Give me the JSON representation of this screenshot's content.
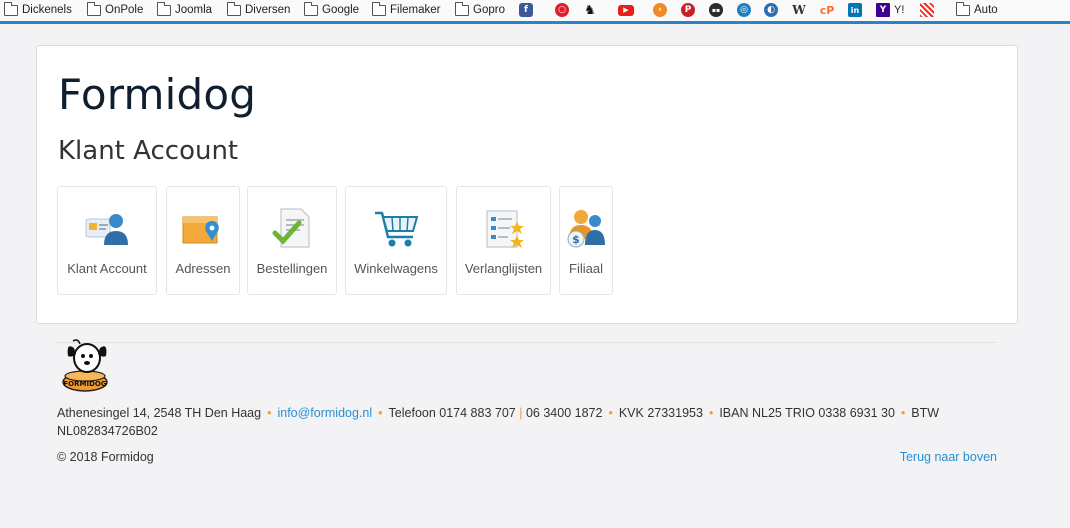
{
  "bookmarks": {
    "folders": [
      {
        "label": "Dickenels"
      },
      {
        "label": "OnPole"
      },
      {
        "label": "Joomla"
      },
      {
        "label": "Diversen"
      },
      {
        "label": "Google"
      },
      {
        "label": "Filemaker"
      },
      {
        "label": "Gopro"
      }
    ],
    "icons": [
      {
        "name": "facebook-icon",
        "glyph": "f",
        "color": "#3b5998"
      },
      {
        "name": "target-icon",
        "glyph": "◉",
        "color": "#e01e2b"
      },
      {
        "name": "dog-icon",
        "glyph": "♞",
        "color": "#111111"
      },
      {
        "name": "youtube-icon",
        "glyph": "▶",
        "color": "#e62117"
      },
      {
        "name": "orange-circle-icon",
        "glyph": "›",
        "color": "#f08a24"
      },
      {
        "name": "pinterest-icon",
        "glyph": "P",
        "color": "#cb2027"
      },
      {
        "name": "round-badge-icon",
        "glyph": "●",
        "color": "#2b2b2b"
      },
      {
        "name": "map-pin-icon",
        "glyph": "◎",
        "color": "#1f7fbf"
      },
      {
        "name": "blue-sphere-icon",
        "glyph": "◐",
        "color": "#2d6fb4"
      },
      {
        "name": "wikipedia-icon",
        "glyph": "W",
        "color": "#555555"
      },
      {
        "name": "cpanel-icon",
        "glyph": "cP",
        "color": "#ff6c2c"
      },
      {
        "name": "linkedin-icon",
        "glyph": "in",
        "color": "#0077b5"
      },
      {
        "name": "yahoo-icon",
        "glyph": "Y",
        "color": "#400090"
      }
    ],
    "yahoo_label": "Y!",
    "last_folder": "Auto"
  },
  "site": {
    "title": "Formidog",
    "page_title": "Klant Account"
  },
  "tiles": [
    {
      "label": "Klant Account",
      "icon": "user-card-icon"
    },
    {
      "label": "Adressen",
      "icon": "address-box-icon"
    },
    {
      "label": "Bestellingen",
      "icon": "orders-document-icon"
    },
    {
      "label": "Winkelwagens",
      "icon": "shopping-cart-icon"
    },
    {
      "label": "Verlanglijsten",
      "icon": "wishlist-icon"
    },
    {
      "label": "Filiaal",
      "icon": "affiliate-icon"
    }
  ],
  "footer": {
    "address": "Athenesingel 14, 2548 TH Den Haag",
    "email": "info@formidog.nl",
    "phone_label": "Telefoon 0174 883 707",
    "phone_sep": "|",
    "mobile": "06 3400 1872",
    "kvk": "KVK 27331953",
    "iban": "IBAN NL25 TRIO 0338 6931 30",
    "btw": "BTW NL082834726B02",
    "copyright": "© 2018 Formidog",
    "back_to_top": "Terug naar boven",
    "logo_text": "FORMIDOG"
  },
  "colors": {
    "accent_blue": "#2b83c5",
    "link": "#2a8fd0",
    "dot": "#f0a030"
  }
}
